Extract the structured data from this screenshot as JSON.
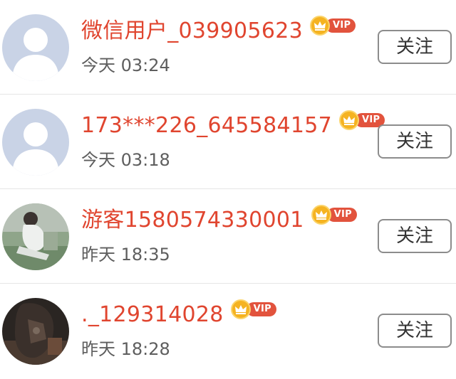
{
  "users": [
    {
      "name": "微信用户_039905623",
      "vip_label": "VIP",
      "time": "今天 03:24",
      "follow_label": "关注",
      "avatar": "default-avatar"
    },
    {
      "name": "173***226_645584157",
      "vip_label": "VIP",
      "time": "今天 03:18",
      "follow_label": "关注",
      "avatar": "default-avatar"
    },
    {
      "name": "游客1580574330001",
      "vip_label": "VIP",
      "time": "昨天 18:35",
      "follow_label": "关注",
      "avatar": "photo-avatar-light"
    },
    {
      "name": "._129314028",
      "vip_label": "VIP",
      "time": "昨天 18:28",
      "follow_label": "关注",
      "avatar": "photo-avatar-dark"
    }
  ],
  "colors": {
    "name": "#e0452f",
    "time": "#5e5e5e",
    "vip_pill": "#e2533d",
    "vip_crown": "#f5b321",
    "button_border": "#8c8c8c",
    "divider": "#e6e6e6"
  }
}
